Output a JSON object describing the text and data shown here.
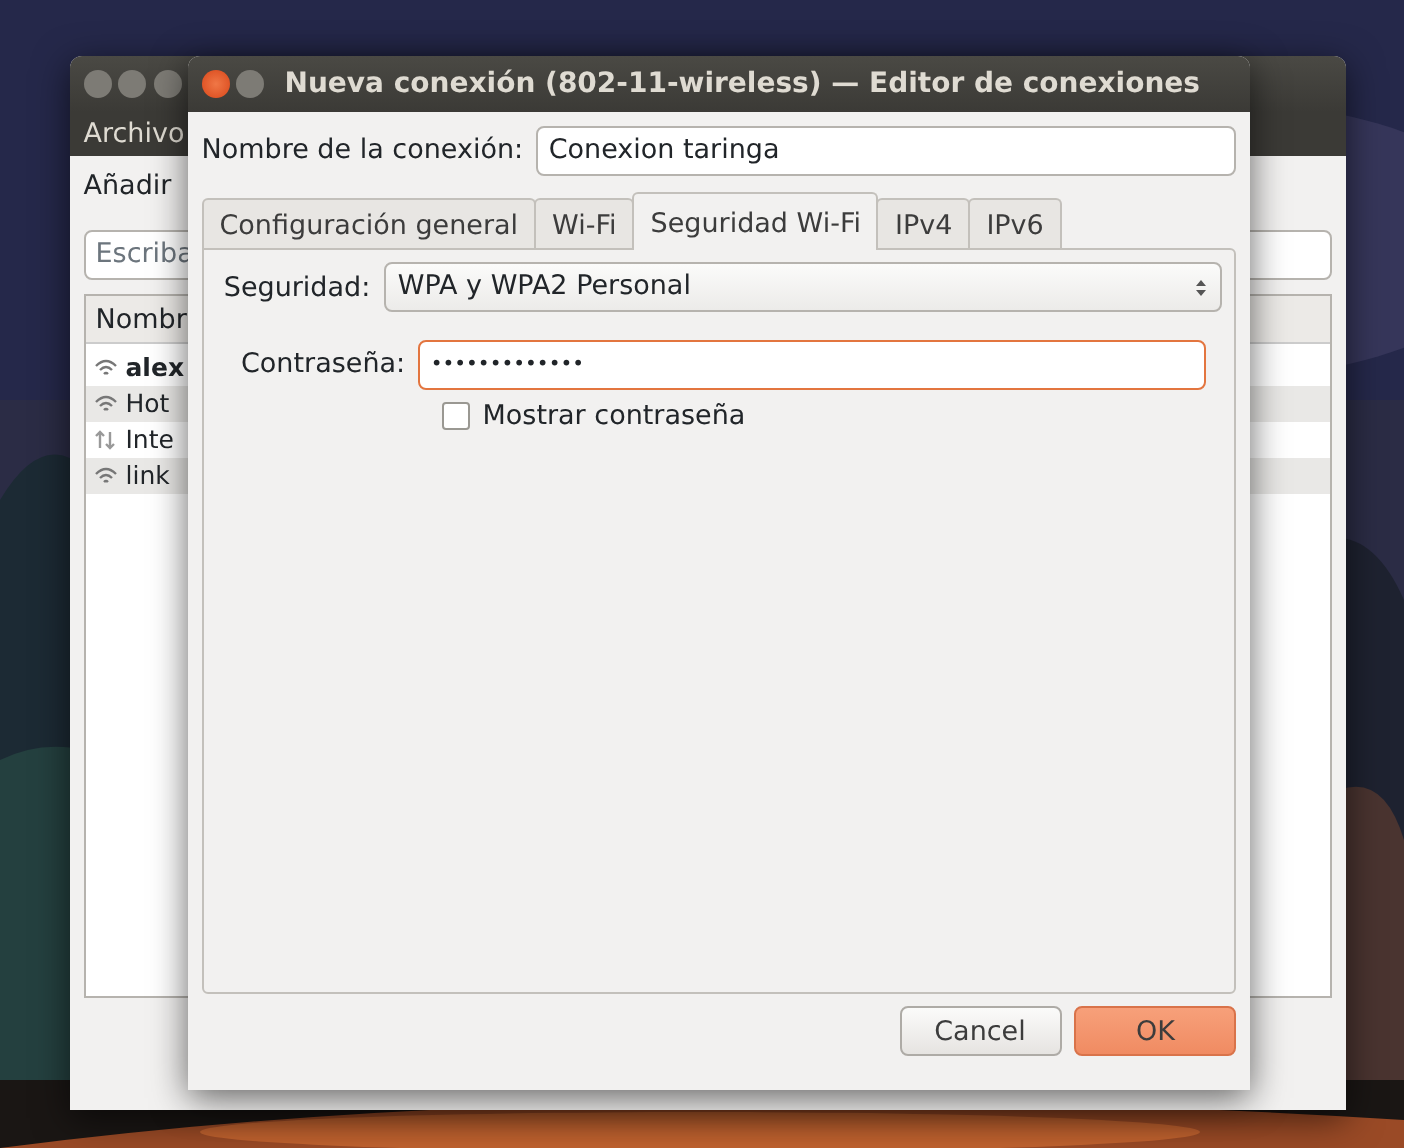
{
  "back_window": {
    "menu": [
      "Archivo"
    ],
    "toolbar": [
      "Añadir"
    ],
    "search": {
      "placeholder": "Escriba"
    },
    "list": {
      "column": "Nombr",
      "rows": [
        {
          "name": "alex",
          "kind": "wifi",
          "active": true
        },
        {
          "name": "Hot",
          "kind": "wifi",
          "active": false
        },
        {
          "name": "Inte",
          "kind": "wired",
          "active": false
        },
        {
          "name": "link",
          "kind": "wifi",
          "active": false
        }
      ]
    }
  },
  "dialog": {
    "title": "Nueva conexión (802-11-wireless) — Editor de conexiones",
    "name_label": "Nombre de la conexión:",
    "name_value": "Conexion taringa",
    "tabs": [
      {
        "label": "Configuración general",
        "selected": false
      },
      {
        "label": "Wi-Fi",
        "selected": false
      },
      {
        "label": "Seguridad Wi-Fi",
        "selected": true
      },
      {
        "label": "IPv4",
        "selected": false
      },
      {
        "label": "IPv6",
        "selected": false
      }
    ],
    "security_label": "Seguridad:",
    "security_value": "WPA y WPA2 Personal",
    "password_label": "Contraseña:",
    "password_value": "•••••••••••••",
    "password_focused": true,
    "show_password": {
      "label": "Mostrar contraseña",
      "checked": false
    },
    "buttons": [
      {
        "label": "Cancel",
        "kind": "normal"
      },
      {
        "label": "OK",
        "kind": "default"
      }
    ]
  }
}
